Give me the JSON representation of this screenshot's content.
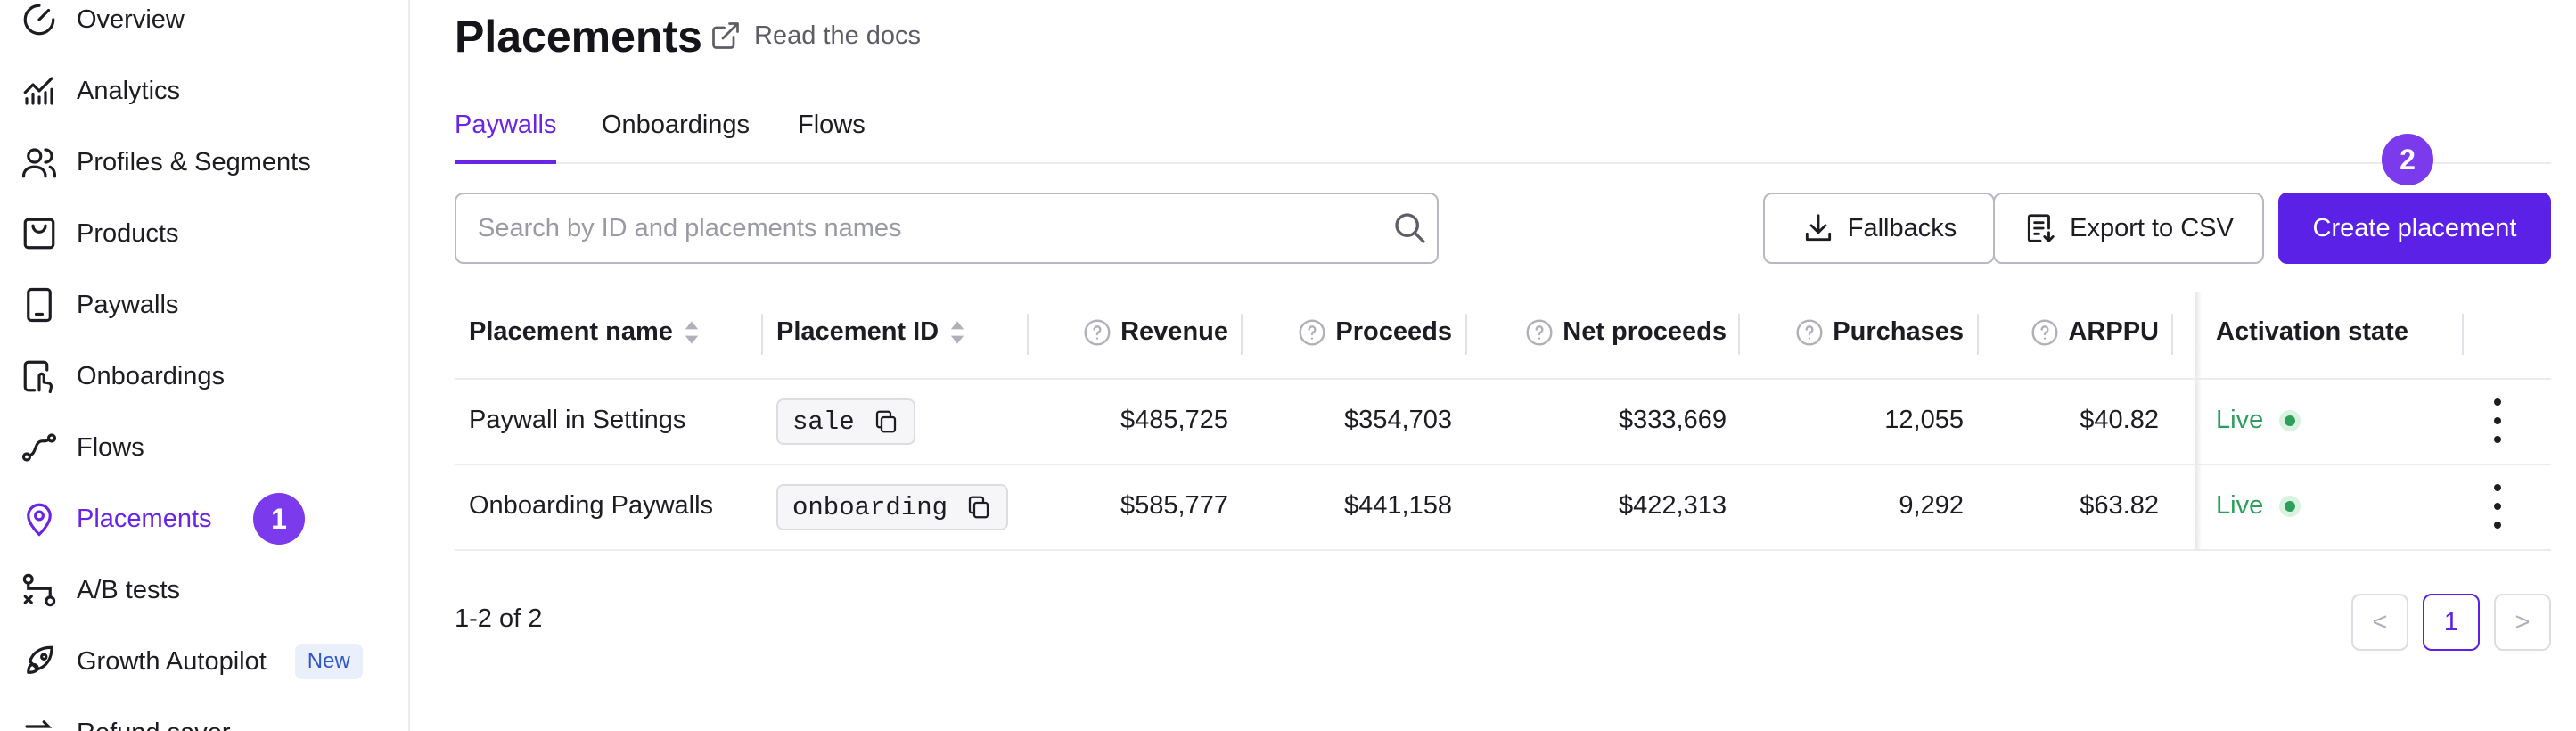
{
  "sidebar": {
    "items": [
      {
        "label": "Overview",
        "icon": "speedometer-icon"
      },
      {
        "label": "Analytics",
        "icon": "chart-line-icon"
      },
      {
        "label": "Profiles & Segments",
        "icon": "users-icon"
      },
      {
        "label": "Products",
        "icon": "shopping-bag-icon"
      },
      {
        "label": "Paywalls",
        "icon": "phone-icon"
      },
      {
        "label": "Onboardings",
        "icon": "tap-icon"
      },
      {
        "label": "Flows",
        "icon": "flow-icon"
      },
      {
        "label": "Placements",
        "icon": "map-pin-icon",
        "active": true
      },
      {
        "label": "A/B tests",
        "icon": "split-icon"
      },
      {
        "label": "Growth Autopilot",
        "icon": "rocket-icon",
        "badge": "New"
      },
      {
        "label": "Refund saver",
        "icon": "refund-icon"
      }
    ],
    "step_badge": "1"
  },
  "header": {
    "title": "Placements",
    "docs_link": "Read the docs"
  },
  "tabs": [
    {
      "label": "Paywalls",
      "active": true
    },
    {
      "label": "Onboardings"
    },
    {
      "label": "Flows"
    }
  ],
  "search": {
    "placeholder": "Search by ID and placements names",
    "value": ""
  },
  "toolbar": {
    "fallbacks_label": "Fallbacks",
    "export_label": "Export to CSV",
    "create_label": "Create placement",
    "step_badge": "2"
  },
  "table": {
    "columns": {
      "name": "Placement name",
      "id": "Placement ID",
      "revenue": "Revenue",
      "proceeds": "Proceeds",
      "net_proceeds": "Net proceeds",
      "purchases": "Purchases",
      "arppu": "ARPPU",
      "state": "Activation state"
    },
    "rows": [
      {
        "name": "Paywall in Settings",
        "id": "sale",
        "revenue": "$485,725",
        "proceeds": "$354,703",
        "net_proceeds": "$333,669",
        "purchases": "12,055",
        "arppu": "$40.82",
        "state": "Live"
      },
      {
        "name": "Onboarding Paywalls",
        "id": "onboarding",
        "revenue": "$585,777",
        "proceeds": "$441,158",
        "net_proceeds": "$422,313",
        "purchases": "9,292",
        "arppu": "$63.82",
        "state": "Live"
      }
    ]
  },
  "pagination": {
    "summary": "1-2 of 2",
    "current_page": "1",
    "prev": "<",
    "next": ">"
  },
  "colors": {
    "accent": "#6a24e6",
    "primary_button": "#5b21e6",
    "badge": "#7c3aed",
    "live": "#2e9e5b"
  }
}
